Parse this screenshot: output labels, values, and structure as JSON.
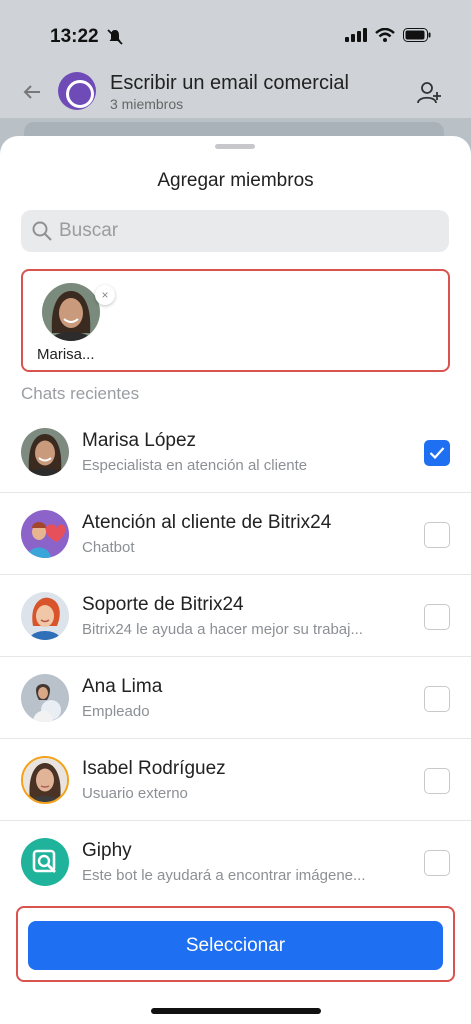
{
  "status": {
    "time": "13:22"
  },
  "chat": {
    "title": "Escribir un email comercial",
    "subtitle": "3 miembros"
  },
  "sheet": {
    "title": "Agregar miembros",
    "search_placeholder": "Buscar",
    "selected": [
      {
        "name": "Marisa..."
      }
    ],
    "section_label": "Chats recientes",
    "items": [
      {
        "name": "Marisa López",
        "subtitle": "Especialista en atención al cliente",
        "checked": true,
        "avatar": "woman-avatar"
      },
      {
        "name": "Atención al cliente de Bitrix24",
        "subtitle": "Chatbot",
        "checked": false,
        "avatar": "heart-bot-avatar"
      },
      {
        "name": "Soporte de Bitrix24",
        "subtitle": "Bitrix24 le ayuda a hacer mejor su trabaj...",
        "checked": false,
        "avatar": "support-avatar"
      },
      {
        "name": "Ana Lima",
        "subtitle": "Empleado",
        "checked": false,
        "avatar": "woman-avatar"
      },
      {
        "name": "Isabel Rodríguez",
        "subtitle": "Usuario externo",
        "checked": false,
        "avatar": "woman-avatar"
      },
      {
        "name": "Giphy",
        "subtitle": "Este bot le ayudará a encontrar imágene...",
        "checked": false,
        "avatar": "giphy-icon"
      }
    ],
    "button_label": "Seleccionar"
  },
  "colors": {
    "accent": "#1e6ff1",
    "highlight": "#d9534f"
  }
}
